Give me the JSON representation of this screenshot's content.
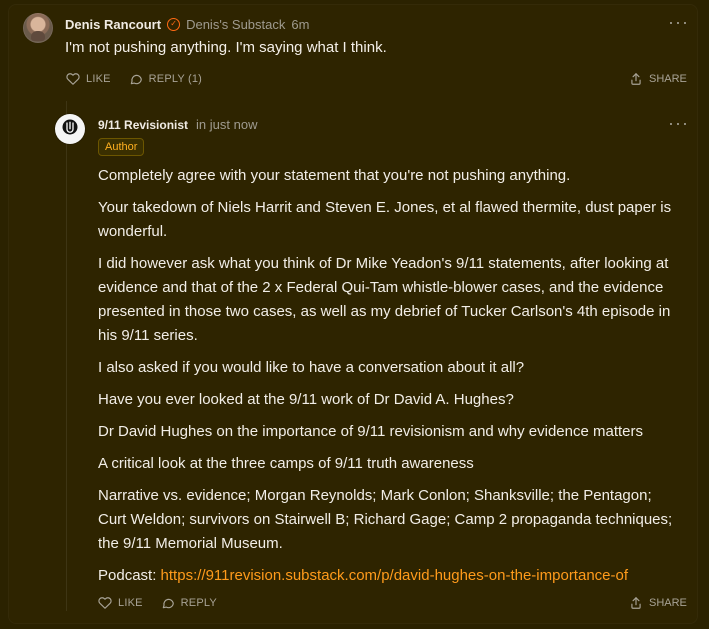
{
  "top_comment": {
    "author": "Denis Rancourt",
    "publication": "Denis's Substack",
    "time": "6m",
    "text": "I'm not pushing anything. I'm saying what I think.",
    "actions": {
      "like": "LIKE",
      "reply": "REPLY (1)",
      "share": "SHARE"
    }
  },
  "reply": {
    "author": "9/11 Revisionist",
    "time": "in just now",
    "badge": "Author",
    "paragraphs": [
      "Completely agree with your statement that you're not pushing anything.",
      "Your takedown of Niels Harrit and Steven E. Jones, et al flawed thermite, dust paper is wonderful.",
      "I did however ask what you think of Dr Mike Yeadon's 9/11 statements, after looking at evidence and that of the 2 x Federal Qui-Tam whistle-blower cases, and the evidence presented in those two cases, as well as my debrief of Tucker Carlson's 4th episode in his 9/11 series.",
      "I also asked if you would like to have a conversation about it all?",
      "Have you ever looked at the 9/11 work of Dr David A. Hughes?",
      "Dr David Hughes on the importance of 9/11 revisionism and why evidence matters",
      "A critical look at the three camps of 9/11 truth awareness",
      "Narrative vs. evidence; Morgan Reynolds; Mark Conlon; Shanksville; the Pentagon; Curt Weldon; survivors on Stairwell B; Richard Gage; Camp 2 propaganda techniques; the 9/11 Memorial Museum."
    ],
    "podcast_label": "Podcast: ",
    "podcast_url": "https://911revision.substack.com/p/david-hughes-on-the-importance-of",
    "actions": {
      "like": "LIKE",
      "reply": "REPLY",
      "share": "SHARE"
    }
  },
  "colors": {
    "background": "#2b2200",
    "card": "#2e2400",
    "accent": "#ff6a13",
    "link": "#ff9b1b",
    "badge_text": "#ffb020"
  },
  "icons": {
    "verified_badge": "verified-icon",
    "menu": "more-horizontal-icon",
    "like": "heart-icon",
    "reply": "speech-bubble-icon",
    "share": "share-arrow-icon",
    "reply_avatar": "logo-avatar-icon",
    "top_avatar": "profile-avatar-icon"
  }
}
